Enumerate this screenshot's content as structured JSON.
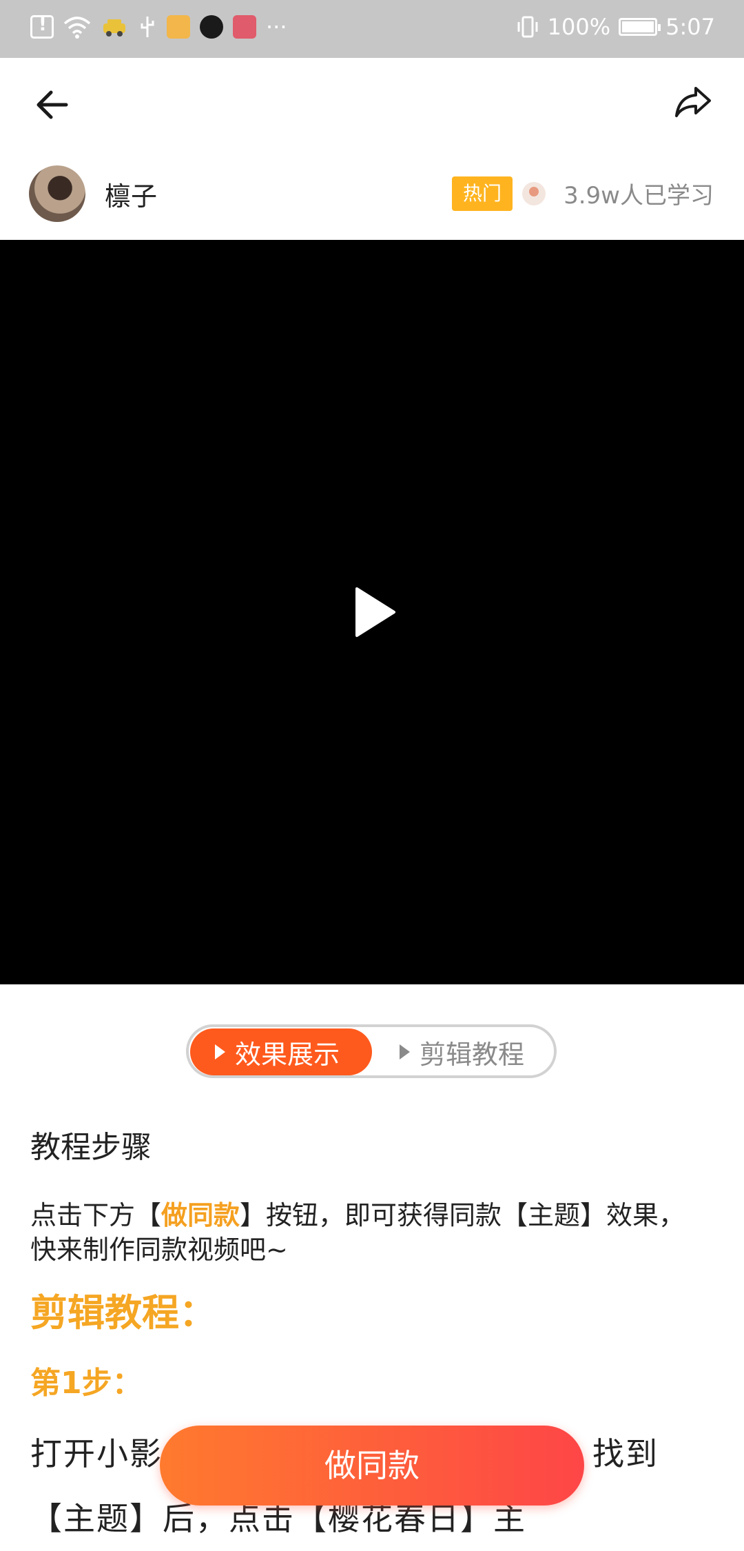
{
  "status_bar": {
    "more": "···",
    "battery_percent": "100%",
    "time": "5:07"
  },
  "author": {
    "name": "檩子"
  },
  "badge": {
    "label": "热门"
  },
  "learners": {
    "text": "3.9w人已学习"
  },
  "tabs": {
    "effect": "效果展示",
    "tutorial": "剪辑教程"
  },
  "content": {
    "steps_title": "教程步骤",
    "intro_prefix": "点击下方【",
    "intro_highlight": "做同款",
    "intro_suffix": "】按钮，即可获得同款【主题】效果，快来制作同款视频吧~",
    "section_title": "剪辑教程：",
    "step1_title": "第1步：",
    "step1_text": "打开小影，导入一段或几段樱花视频，找到【主题】后，点击【樱花春日】主"
  },
  "actions": {
    "make_same": "做同款"
  },
  "colors": {
    "accent_orange": "#ff5a1d",
    "highlight_gold": "#f5a623",
    "hot_badge": "#ffb41f",
    "button_gradient_start": "#ff7a2e",
    "button_gradient_end": "#fe4647"
  }
}
